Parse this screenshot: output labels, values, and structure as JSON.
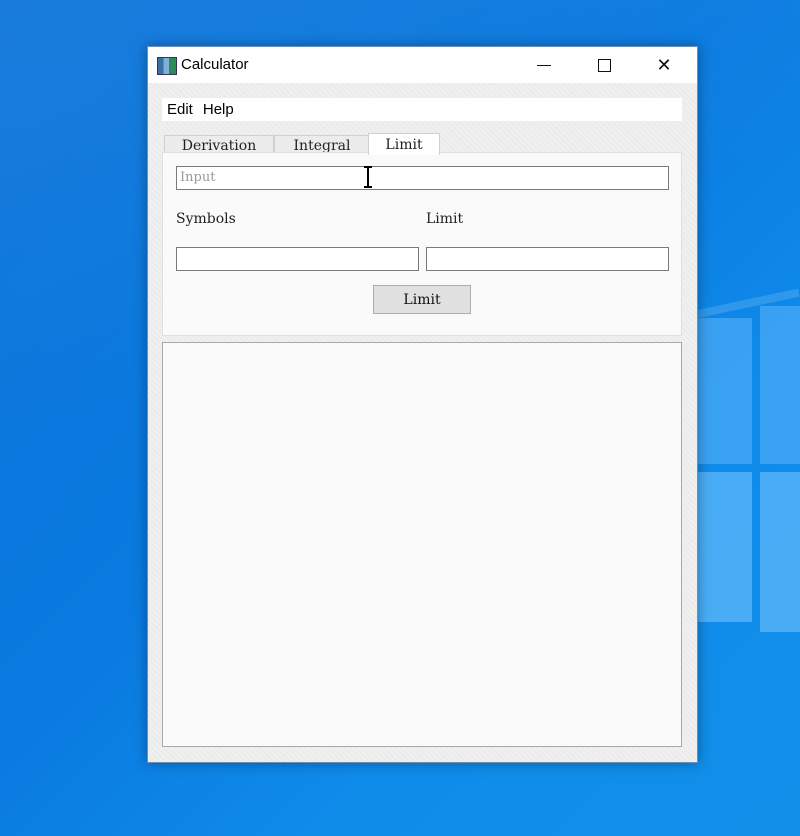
{
  "window": {
    "title": "Calculator",
    "controls": {
      "minimize": "—",
      "maximize": "☐",
      "close": "✕"
    }
  },
  "menu": {
    "items": [
      "Edit",
      "Help"
    ]
  },
  "tabs": [
    {
      "label": "Derivation",
      "active": false
    },
    {
      "label": "Integral",
      "active": false
    },
    {
      "label": "Limit",
      "active": true
    }
  ],
  "form": {
    "input_placeholder": "Input",
    "symbols_label": "Symbols",
    "limit_label": "Limit",
    "symbols_value": "",
    "limit_value": "",
    "submit_label": "Limit"
  },
  "output": {
    "text": ""
  },
  "colors": {
    "desktop": "#0a74dc",
    "window_bg": "#f0f0f0"
  }
}
